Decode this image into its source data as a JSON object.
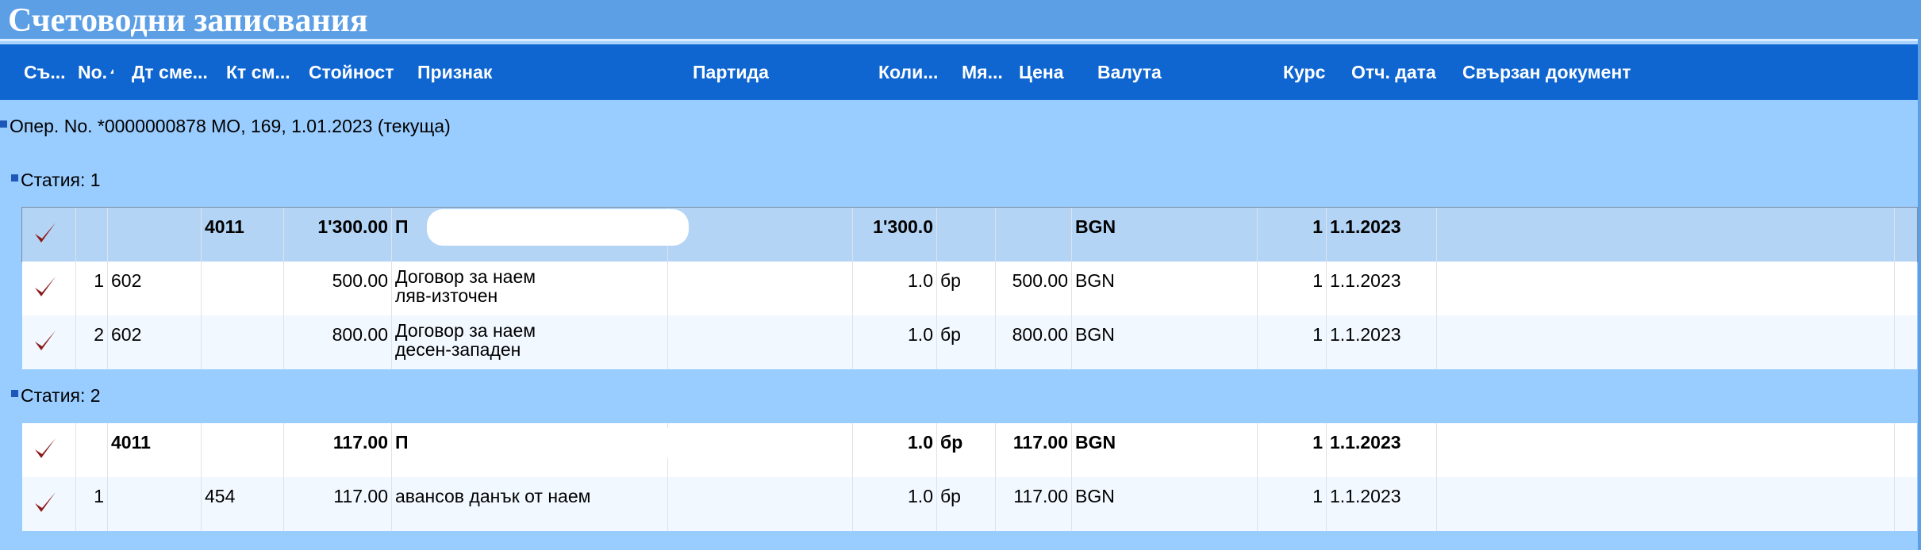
{
  "window": {
    "title": "Счетоводни записвания"
  },
  "columns": {
    "status": "Съ...",
    "no": "No.",
    "no_sort": "▲",
    "debit": "Дт сме...",
    "credit": "Кт см...",
    "amount": "Стойност",
    "sign": "Признак",
    "batch": "Партида",
    "qty": "Коли...",
    "unit": "Мя...",
    "price": "Цена",
    "currency": "Валута",
    "rate": "Курс",
    "date": "Отч. дата",
    "related": "Свързан документ"
  },
  "operation": {
    "label": "Опер. No. *0000000878 МО, 169, 1.01.2023 (текуща)"
  },
  "articles": [
    {
      "label": "Статия: 1",
      "rows": [
        {
          "checked": true,
          "no": "",
          "debit": "",
          "credit": "4011",
          "amount": "1'300.00",
          "sign": "П",
          "batch": "",
          "qty": "1'300.0",
          "unit": "",
          "price": "",
          "currency": "BGN",
          "rate": "1",
          "date": "1.1.2023",
          "related": ""
        },
        {
          "checked": true,
          "no": "1",
          "debit": "602",
          "credit": "",
          "amount": "500.00",
          "sign": "Договор за наем\nляв-източен",
          "batch": "",
          "qty": "1.0",
          "unit": "бр",
          "price": "500.00",
          "currency": "BGN",
          "rate": "1",
          "date": "1.1.2023",
          "related": ""
        },
        {
          "checked": true,
          "no": "2",
          "debit": "602",
          "credit": "",
          "amount": "800.00",
          "sign": "Договор за наем\nдесен-западен",
          "batch": "",
          "qty": "1.0",
          "unit": "бр",
          "price": "800.00",
          "currency": "BGN",
          "rate": "1",
          "date": "1.1.2023",
          "related": ""
        }
      ]
    },
    {
      "label": "Статия: 2",
      "rows": [
        {
          "checked": true,
          "no": "",
          "debit": "4011",
          "credit": "",
          "amount": "117.00",
          "sign": "П",
          "batch": "",
          "qty": "1.0",
          "unit": "бр",
          "price": "117.00",
          "currency": "BGN",
          "rate": "1",
          "date": "1.1.2023",
          "related": ""
        },
        {
          "checked": true,
          "no": "1",
          "debit": "",
          "credit": "454",
          "amount": "117.00",
          "sign": "авансов данък от наем",
          "batch": "",
          "qty": "1.0",
          "unit": "бр",
          "price": "117.00",
          "currency": "BGN",
          "rate": "1",
          "date": "1.1.2023",
          "related": ""
        }
      ]
    }
  ],
  "colors": {
    "title_bg": "#5c9fe5",
    "header_bg": "#0f66d0",
    "content_bg": "#99ccff",
    "check_red": "#8b1a1a",
    "selected_row": "#b3d4f4"
  }
}
